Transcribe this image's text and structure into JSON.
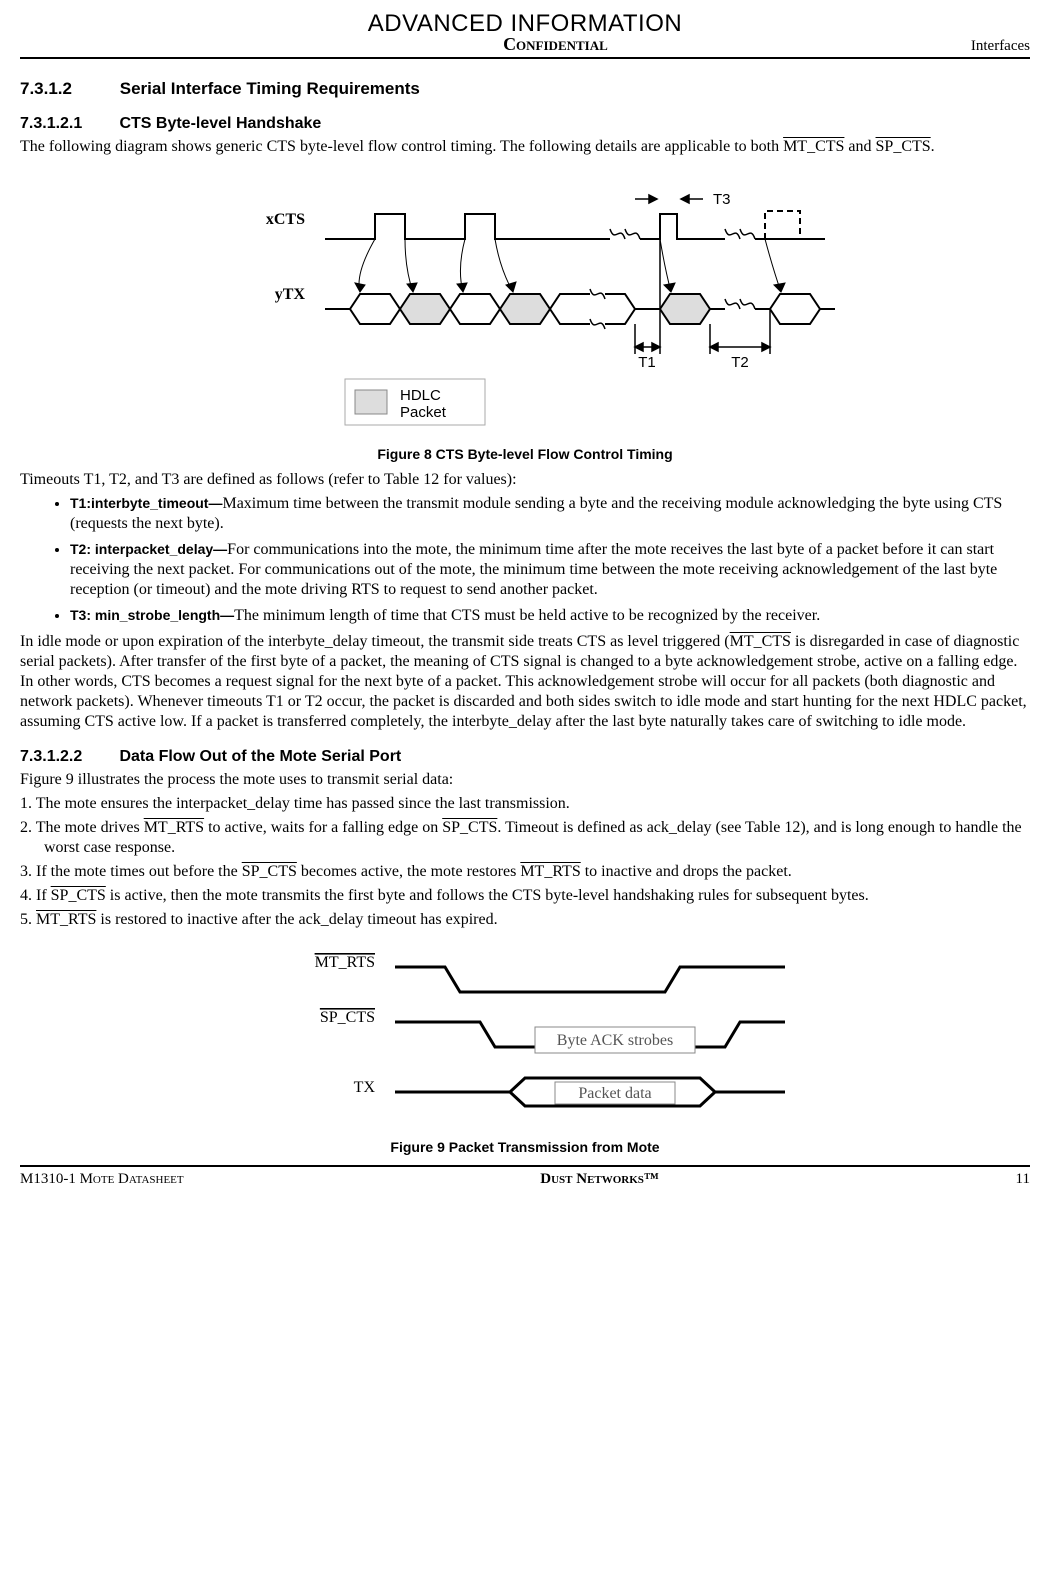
{
  "banner": "ADVANCED INFORMATION",
  "header": {
    "center": "Confidential",
    "right": "Interfaces"
  },
  "s7312": {
    "num": "7.3.1.2",
    "title": "Serial Interface Timing Requirements"
  },
  "s73121": {
    "num": "7.3.1.2.1",
    "title": "CTS Byte-level Handshake",
    "intro_a": "The following diagram shows generic CTS byte-level flow control timing. The following details are applicable to both ",
    "intro_sig1": "MT_CTS",
    "intro_mid": " and ",
    "intro_sig2": "SP_CTS",
    "intro_end": "."
  },
  "fig8": {
    "label_xcts": "xCTS",
    "label_ytx": "yTX",
    "label_t1": "T1",
    "label_t2": "T2",
    "label_t3": "T3",
    "legend1": "HDLC",
    "legend2": "Packet",
    "caption": "Figure 8    CTS Byte-level Flow Control Timing"
  },
  "timeouts_intro": "Timeouts T1, T2, and T3 are defined as follows (refer to Table 12 for values):",
  "bullets": {
    "t1_term": "T1:interbyte_timeout—",
    "t1_body": "Maximum time between the transmit module sending a byte and the receiving module acknowledging the byte using CTS (requests the next byte).",
    "t2_term": "T2: interpacket_delay—",
    "t2_body": "For communications into the mote, the minimum time after the mote receives the last byte of a packet before it can start receiving the next packet. For communications out of the mote, the minimum time between the mote receiving acknowledgement of the last byte reception (or timeout) and the mote driving RTS to request to send another packet.",
    "t3_term": "T3: min_strobe_length—",
    "t3_body": "The minimum length of time that CTS must be held active to be recognized by the receiver."
  },
  "idle_para_a": "In idle mode or upon expiration of the interbyte_delay timeout, the transmit side treats CTS as level triggered (",
  "idle_sig": "MT_CTS",
  "idle_para_b": " is disregarded in case of diagnostic serial packets). After transfer of the first byte of a packet, the meaning of CTS signal is changed to a byte acknowledgement strobe, active on a falling edge. In other words, CTS becomes a request signal for the next byte of a packet. This acknowledgement strobe will occur for all packets (both diagnostic and network packets). Whenever timeouts T1 or T2 occur, the packet is discarded and both sides switch to idle mode and start hunting for the next HDLC packet, assuming CTS active low. If a packet is transferred completely, the interbyte_delay after the last byte naturally takes care of switching to idle mode.",
  "s73122": {
    "num": "7.3.1.2.2",
    "title": "Data Flow Out of the Mote Serial Port",
    "intro": "Figure 9 illustrates the process the mote uses to transmit serial data:",
    "steps": {
      "s1": "1. The mote ensures the interpacket_delay time has passed since the last transmission.",
      "s2a": "2. The mote drives ",
      "s2sig1": "MT_RTS",
      "s2b": " to active, waits for a falling edge on ",
      "s2sig2": "SP_CTS",
      "s2c": ". Timeout is defined as ack_delay (see Table 12), and is long enough to handle the worst case response.",
      "s3a": "3. If the mote times out before the ",
      "s3sig1": "SP_CTS",
      "s3b": " becomes active, the mote restores ",
      "s3sig2": "MT_RTS",
      "s3c": " to inactive and drops the packet.",
      "s4a": "4. If ",
      "s4sig1": "SP_CTS",
      "s4b": " is active, then the mote transmits the first byte and follows the CTS byte-level handshaking rules for subsequent bytes.",
      "s5a": "5. ",
      "s5sig1": "MT_RTS",
      "s5b": " is restored to inactive after the ack_delay timeout has expired."
    }
  },
  "fig9": {
    "label_mtrts": "MT_RTS",
    "label_spcts": "SP_CTS",
    "label_tx": "TX",
    "box_ack": "Byte ACK strobes",
    "box_pkt": "Packet data",
    "caption": "Figure 9    Packet Transmission from Mote"
  },
  "footer": {
    "left": "M1310-1 Mote Datasheet",
    "center": "Dust Networks™",
    "right": "11"
  }
}
